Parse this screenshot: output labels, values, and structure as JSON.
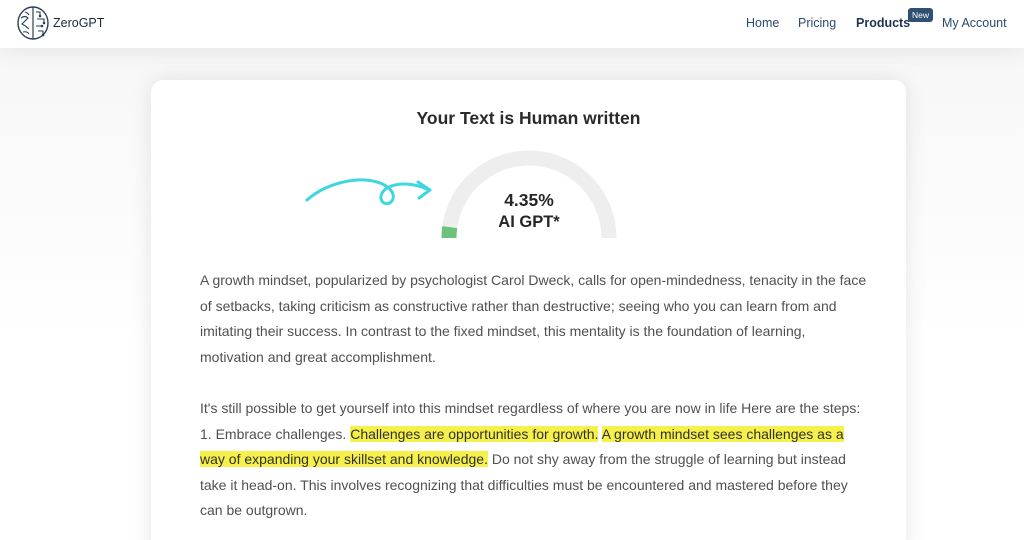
{
  "header": {
    "brand": "ZeroGPT",
    "nav": {
      "home": "Home",
      "pricing": "Pricing",
      "products": "Products",
      "products_badge": "New",
      "account": "My Account"
    }
  },
  "result": {
    "title": "Your Text is Human written",
    "ai_percentage": "4.35%",
    "ai_fraction": 0.0435,
    "ai_label": "AI GPT*",
    "gauge_track_color": "#eeeeee",
    "gauge_fill_color": "#6bc27a",
    "arrow_color": "#3fd6e0"
  },
  "analyzed_text": {
    "paragraph_1": "A growth mindset, popularized by psychologist Carol Dweck, calls for open-mindedness, tenacity in the face of setbacks, taking criticism as constructive rather than destructive; seeing who you can learn from and imitating their success. In contrast to the fixed mindset, this mentality is the foundation of learning, motivation and great accomplishment.",
    "paragraph_2": {
      "intro": "It's still possible to get yourself into this mindset regardless of where you are now in life Here are the steps: 1. Embrace challenges. ",
      "highlight_1": "Challenges are opportunities for growth.",
      "gap": " ",
      "highlight_2": "A growth mindset sees challenges as a way of expanding your skillset and knowledge.",
      "rest": " Do not shy away from the struggle of learning but instead take it head-on. This involves recognizing that difficulties must be encountered and mastered before they can be outgrown."
    },
    "highlight_color": "#f5f04a"
  }
}
